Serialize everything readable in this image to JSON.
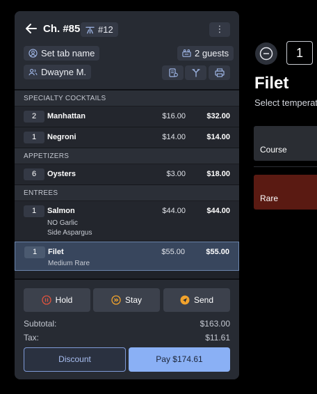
{
  "header": {
    "check_title": "Ch. #85",
    "table_label": "#12",
    "menu_label": "⋮",
    "tab_name_label": "Set tab name",
    "guests_label": "2 guests",
    "server_name": "Dwayne M."
  },
  "sections": [
    {
      "title": "SPECIALTY COCKTAILS",
      "items": [
        {
          "qty": "2",
          "name": "Manhattan",
          "price": "$16.00",
          "total": "$32.00",
          "mods": []
        },
        {
          "qty": "1",
          "name": "Negroni",
          "price": "$14.00",
          "total": "$14.00",
          "mods": []
        }
      ]
    },
    {
      "title": "APPETIZERS",
      "items": [
        {
          "qty": "6",
          "name": "Oysters",
          "price": "$3.00",
          "total": "$18.00",
          "mods": []
        }
      ]
    },
    {
      "title": "ENTREES",
      "items": [
        {
          "qty": "1",
          "name": "Salmon",
          "price": "$44.00",
          "total": "$44.00",
          "mods": [
            "NO Garlic",
            "Side Aspargus"
          ]
        },
        {
          "qty": "1",
          "name": "Filet",
          "price": "$55.00",
          "total": "$55.00",
          "mods": [
            "Medium Rare"
          ],
          "selected": true
        }
      ]
    }
  ],
  "actions": {
    "hold_label": "Hold",
    "stay_label": "Stay",
    "send_label": "Send"
  },
  "summary": {
    "subtotal_label": "Subtotal:",
    "subtotal_value": "$163.00",
    "tax_label": "Tax:",
    "tax_value": "$11.61",
    "discount_label": "Discount",
    "pay_label": "Pay $174.61"
  },
  "edit_pane": {
    "quantity": "1",
    "item_title": "Filet",
    "subtitle": "Select temperature",
    "options": [
      {
        "label": "Course",
        "color": "#2a2d33"
      },
      {
        "label": "Rare",
        "color": "#5a1a12"
      }
    ]
  },
  "colors": {
    "accent": "#8ab0f5",
    "hold": "#e0533d",
    "stay": "#f2a32c",
    "send": "#f2a32c",
    "selected_row": "#38465d"
  },
  "icons": [
    "back-arrow-icon",
    "table-icon",
    "more-vertical-icon",
    "user-circle-icon",
    "guests-icon",
    "users-icon",
    "receipt-split-icon",
    "fork-icon",
    "printer-icon",
    "pause-icon",
    "fast-forward-icon",
    "send-icon",
    "minus-icon"
  ]
}
